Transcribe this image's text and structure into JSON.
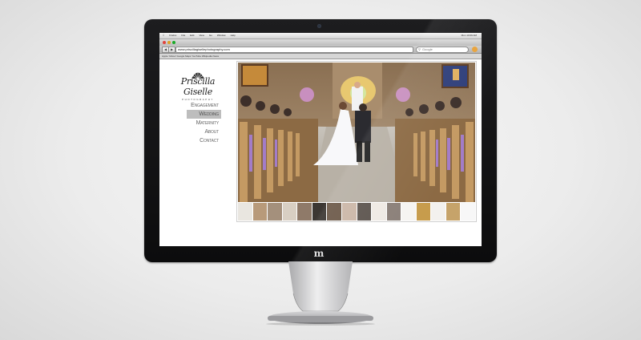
{
  "browser": {
    "menubar": [
      "Firefox",
      "File",
      "Edit",
      "View",
      "Go",
      "Window",
      "Help"
    ],
    "clock": "Mon 10:09 AM",
    "url": "www.priscillagisellephotography.com",
    "search_placeholder": "Google",
    "bookmarks": "Apple  Yahoo!  Google Maps  YouTube  Wikipedia  News"
  },
  "site": {
    "brand": {
      "name": "Priscilla Giselle",
      "subtitle": "PHOTOGRAPHY"
    },
    "nav": [
      {
        "label": "Engagement"
      },
      {
        "label": "Wedding",
        "active": true
      },
      {
        "label": "Maternity"
      },
      {
        "label": "About"
      },
      {
        "label": "Contact"
      }
    ]
  },
  "monitor": {
    "brand_mark": "m"
  },
  "colors": {
    "bezel": "#111214",
    "nav_active_bg": "#bdbdbd",
    "nav_text": "#666666"
  }
}
